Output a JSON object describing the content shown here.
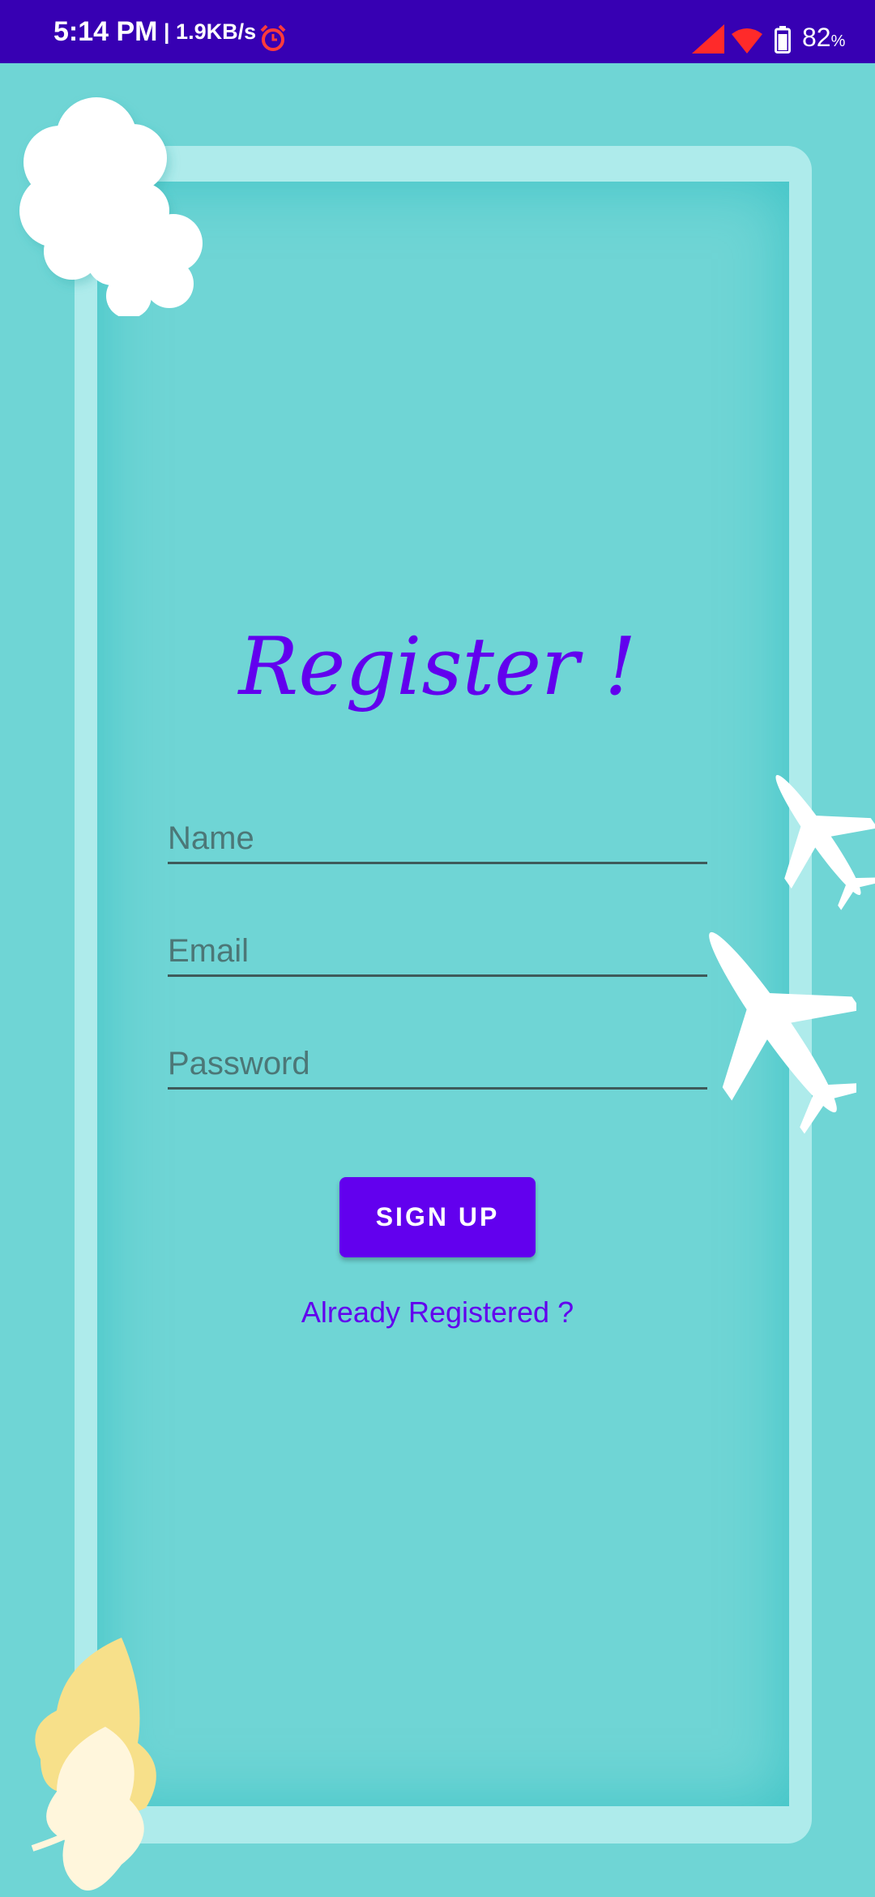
{
  "status_bar": {
    "time": "5:14 PM",
    "network_speed": "| 1.9KB/s",
    "battery_level": "82",
    "battery_unit": "%",
    "alarm_icon": "alarm-clock-icon",
    "signal_icon": "cellular-signal-icon",
    "wifi_icon": "wifi-icon",
    "battery_icon": "battery-icon",
    "colors": {
      "background": "#3700b3",
      "alarm": "#ff3b3b",
      "signal": "#ff2a2a"
    }
  },
  "form": {
    "title": "Register !",
    "name_placeholder": "Name",
    "email_placeholder": "Email",
    "password_placeholder": "Password",
    "signup_label": "SIGN UP",
    "login_link_label": "Already Registered ?"
  },
  "decorations": {
    "cloud": "cloud-icon",
    "planes": [
      "airplane-icon",
      "airplane-icon"
    ],
    "leaves": "leaves-icon"
  },
  "theme": {
    "accent": "#6200ee",
    "background": "#6fd5d5",
    "frame": "#aeebeb"
  }
}
